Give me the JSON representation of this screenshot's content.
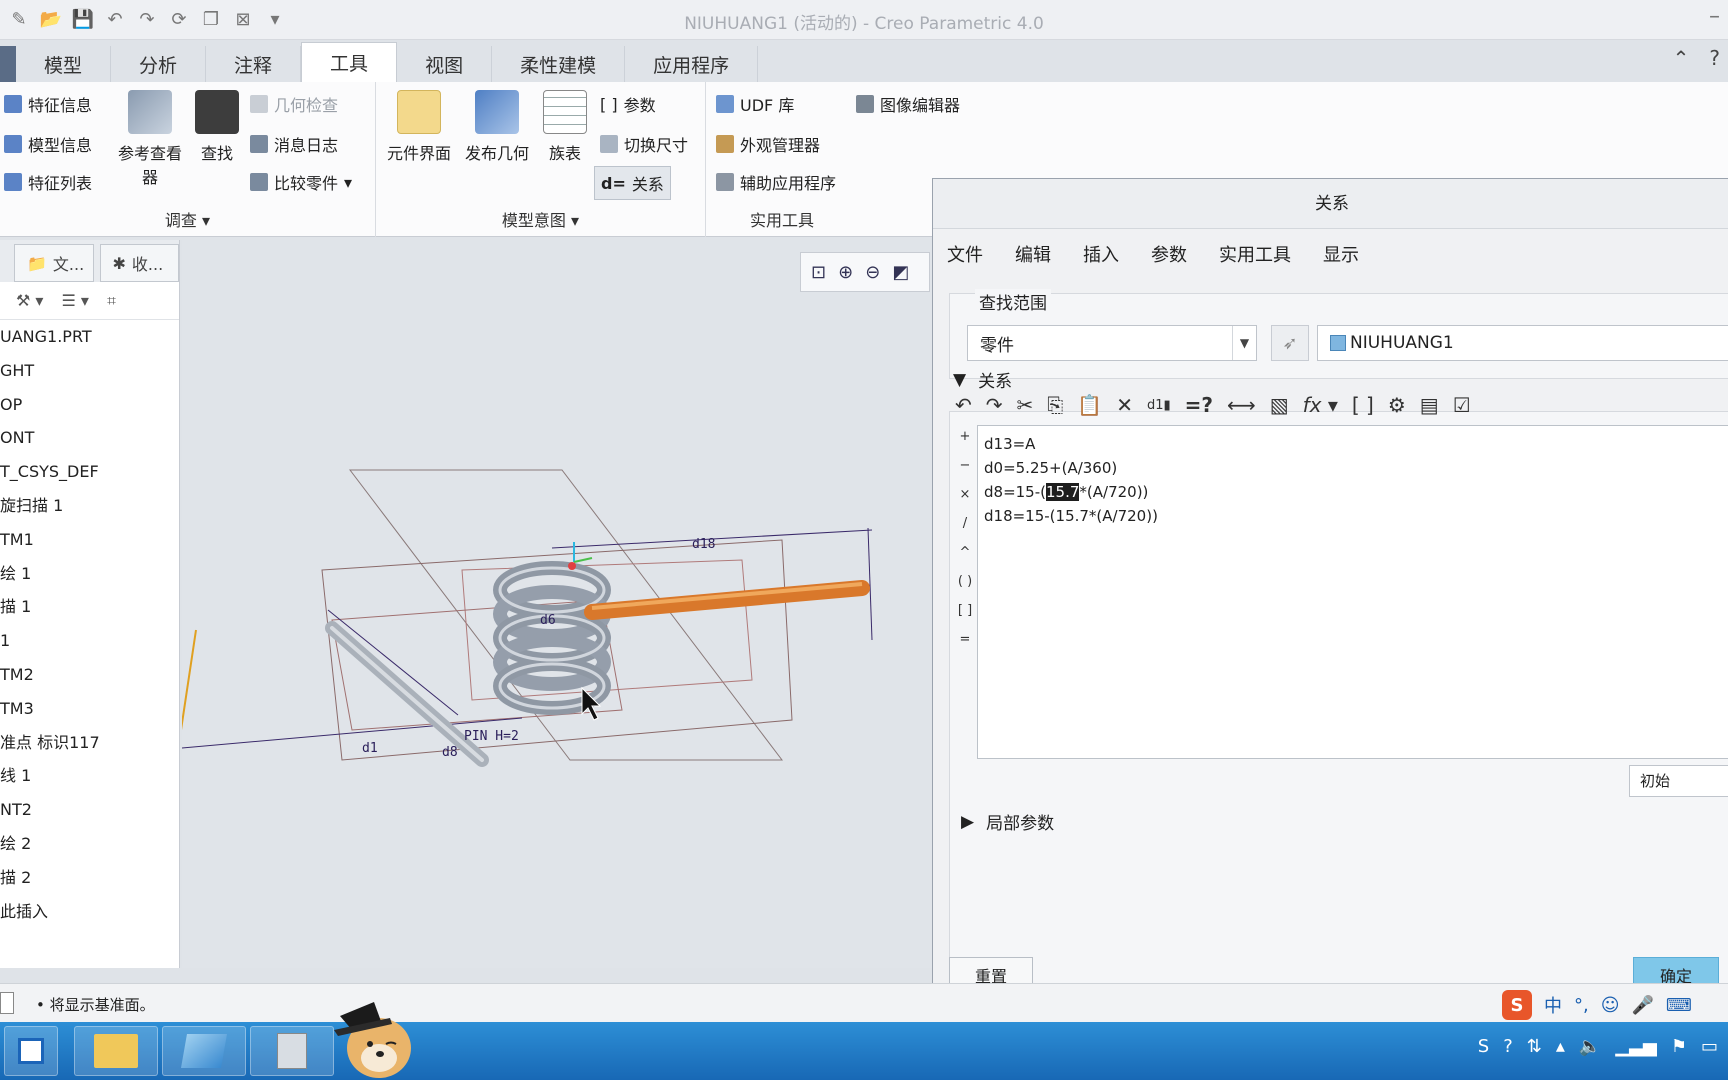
{
  "window": {
    "title": "NIUHUANG1 (活动的) - Creo Parametric 4.0"
  },
  "ribbon_tabs": [
    "模型",
    "分析",
    "注释",
    "工具",
    "视图",
    "柔性建模",
    "应用程序"
  ],
  "ribbon": {
    "investigate": {
      "label": "调查",
      "feature_info": "特征信息",
      "model_info": "模型信息",
      "feature_list": "特征列表",
      "reference_viewer": "参考查看器",
      "find": "查找",
      "geometry_check": "几何检查",
      "message_log": "消息日志",
      "compare_part": "比较零件"
    },
    "model_intent": {
      "label": "模型意图",
      "component_interface": "元件界面",
      "publish_geometry": "发布几何",
      "family_table": "族表",
      "parameters": "参数",
      "switch_dimensions": "切换尺寸",
      "relations": "关系"
    },
    "utilities": {
      "label": "实用工具",
      "udf_library": "UDF 库",
      "appearance_manager": "外观管理器",
      "auxiliary_apps": "辅助应用程序",
      "image_editor": "图像编辑器"
    }
  },
  "tree": {
    "tabs": [
      "文...",
      "收..."
    ],
    "items": [
      "UANG1.PRT",
      "GHT",
      "OP",
      "ONT",
      "T_CSYS_DEF",
      "旋扫描 1",
      "TM1",
      "绘 1",
      "描 1",
      "1",
      "TM2",
      "TM3",
      "准点 标识117",
      "线 1",
      "NT2",
      "绘 2",
      "描 2",
      "此插入"
    ]
  },
  "viewport": {
    "dim_labels": [
      "d18",
      "d6",
      "d8",
      "d1",
      "PIN H=2"
    ]
  },
  "dialog": {
    "title": "关系",
    "menu": [
      "文件",
      "编辑",
      "插入",
      "参数",
      "实用工具",
      "显示"
    ],
    "scope_label": "查找范围",
    "scope_type": "零件",
    "scope_object": "NIUHUANG1",
    "relations_label": "关系",
    "operators": [
      "+",
      "−",
      "×",
      "/",
      "^",
      "( )",
      "[ ]",
      "="
    ],
    "relations_lines": [
      {
        "pre": "d13=A",
        "hl": "",
        "post": ""
      },
      {
        "pre": "d0=5.25+(A/360)",
        "hl": "",
        "post": ""
      },
      {
        "pre": "d8=15-(",
        "hl": "15.7",
        "post": "*(A/720))"
      },
      {
        "pre": "d18=15-(15.7*(A/720))",
        "hl": "",
        "post": ""
      }
    ],
    "initial_value": "初始",
    "local_params_label": "局部参数",
    "reset_label": "重置",
    "ok_label": "确定"
  },
  "status": {
    "message": "• 将显示基准面。"
  },
  "ime": {
    "lang": "中"
  },
  "colors": {
    "ribbon_bg": "#fbfbfc",
    "viewport_bg": "#e0e4e9",
    "spring": "#9aa4b0",
    "selected_arm": "#d9782b",
    "ok_button": "#7fc7e9",
    "taskbar": "#1868b5"
  }
}
